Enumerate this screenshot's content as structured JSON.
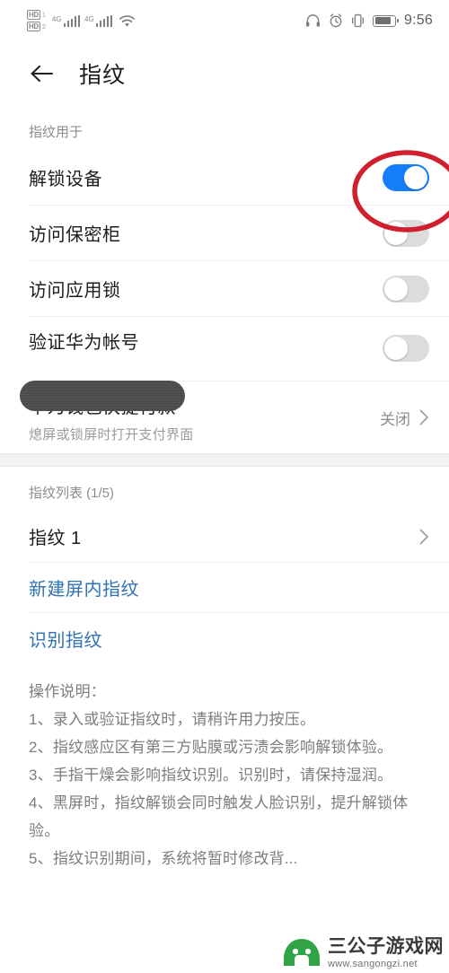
{
  "status_bar": {
    "hd_badge_primary": "HD",
    "hd_badge_primary_sub": "1",
    "hd_badge_secondary": "HD",
    "hd_badge_secondary_sub": "2",
    "network_1": "4G",
    "network_2": "4G",
    "icons": [
      "hd-volte-icon",
      "signal-bars-icon",
      "wifi-icon",
      "headphone-icon",
      "alarm-icon",
      "vibrate-icon",
      "battery-icon"
    ],
    "time": "9:56"
  },
  "header": {
    "back_icon": "back-arrow-icon",
    "title": "指纹"
  },
  "usage_section": {
    "label": "指纹用于",
    "rows": [
      {
        "title": "解锁设备",
        "toggle": "on"
      },
      {
        "title": "访问保密柜",
        "toggle": "off"
      },
      {
        "title": "访问应用锁",
        "toggle": "off"
      },
      {
        "title": "验证华为帐号",
        "toggle": "off"
      }
    ],
    "wallet": {
      "title": "华为钱包快捷付款",
      "subtitle": "熄屏或锁屏时打开支付界面",
      "value": "关闭"
    }
  },
  "fingerprint_list": {
    "label": "指纹列表 (1/5)",
    "items": [
      {
        "title": "指纹 1"
      }
    ],
    "actions": [
      {
        "label": "新建屏内指纹"
      },
      {
        "label": "识别指纹"
      }
    ]
  },
  "instructions": {
    "heading": "操作说明：",
    "lines": [
      "1、录入或验证指纹时，请稍许用力按压。",
      "2、指纹感应区有第三方贴膜或污渍会影响解锁体验。",
      "3、手指干燥会影响指纹识别。识别时，请保持湿润。",
      "4、黑屏时，指纹解锁会同时触发人脸识别，提升解锁体验。",
      "5、指纹识别期间，系统将暂时修改背..."
    ]
  },
  "annotation": {
    "shape": "ellipse",
    "color": "#d0202f",
    "target": "解锁设备 toggle"
  },
  "watermark": {
    "site_name": "三公子游戏网",
    "url": "www.sangongzi.net"
  },
  "colors": {
    "accent_blue": "#157efb",
    "link_blue": "#2f72b5",
    "annotation_red": "#d0202f",
    "toggle_off": "#dcdcdc",
    "watermark_green": "#2fa447"
  }
}
